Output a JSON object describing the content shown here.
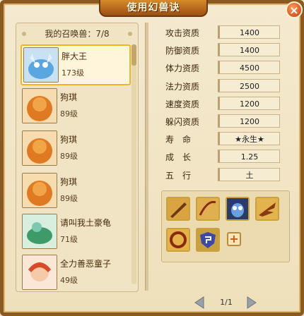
{
  "window": {
    "title": "使用幻兽诀"
  },
  "left": {
    "header": "我的召唤兽：7/8",
    "pets": [
      {
        "name": "胖大王",
        "level": "173级",
        "selected": true,
        "icon": "blue-dragon-portrait"
      },
      {
        "name": "狗琪",
        "level": "89级",
        "selected": false,
        "icon": "orange-beast-portrait"
      },
      {
        "name": "狗琪",
        "level": "89级",
        "selected": false,
        "icon": "orange-beast-portrait"
      },
      {
        "name": "狗琪",
        "level": "89级",
        "selected": false,
        "icon": "orange-beast-portrait"
      },
      {
        "name": "请叫我土豪龟",
        "level": "71级",
        "selected": false,
        "icon": "green-turtle-portrait"
      },
      {
        "name": "全力善恶童子",
        "level": "49级",
        "selected": false,
        "icon": "child-portrait"
      }
    ]
  },
  "stats": [
    {
      "label": "攻击资质",
      "value": "1400"
    },
    {
      "label": "防御资质",
      "value": "1400"
    },
    {
      "label": "体力资质",
      "value": "4500"
    },
    {
      "label": "法力资质",
      "value": "2500"
    },
    {
      "label": "速度资质",
      "value": "1200"
    },
    {
      "label": "躲闪资质",
      "value": "1200"
    },
    {
      "label": "寿　命",
      "value": "★永生★"
    },
    {
      "label": "成　长",
      "value": "1.25"
    },
    {
      "label": "五　行",
      "value": "土"
    }
  ],
  "skills": {
    "icons": [
      "sword-skill-icon",
      "whip-skill-icon",
      "owl-skill-icon",
      "wing-skill-icon",
      "ring-skill-icon",
      "shield-skill-icon"
    ],
    "add_label": "+"
  },
  "pager": {
    "page": "1/1"
  },
  "colors": {
    "frame": "#8a5a22",
    "accent": "#f2b41c",
    "panel": "#f1e4c4"
  }
}
